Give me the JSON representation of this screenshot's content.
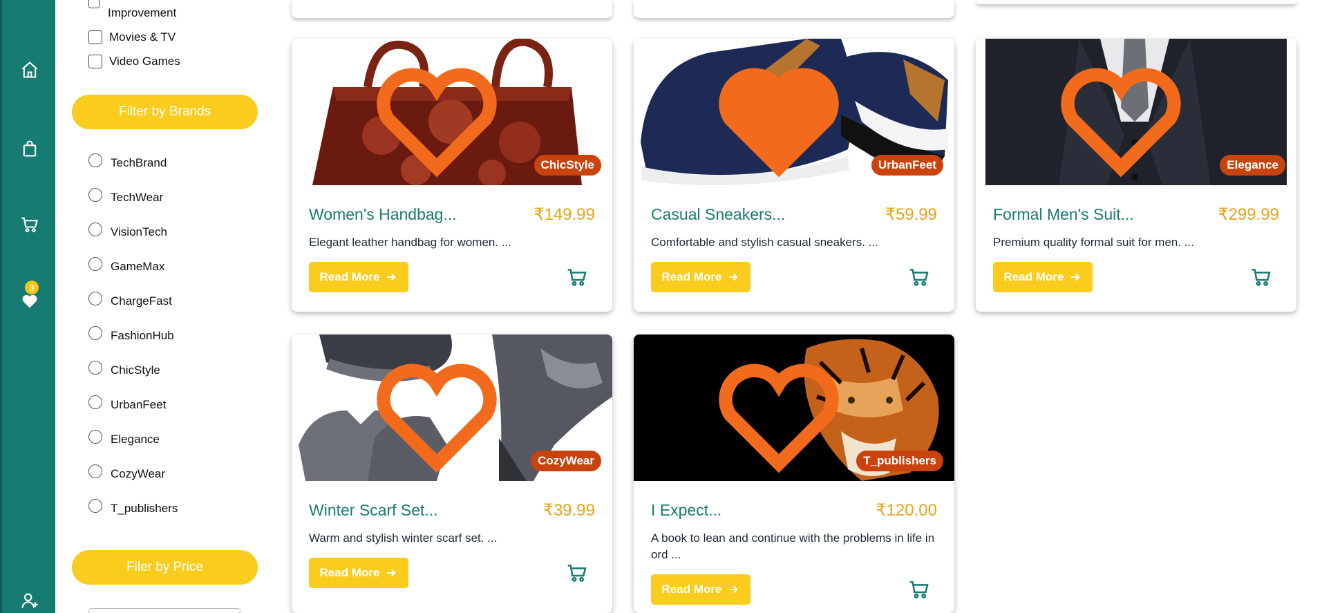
{
  "sidebar": {
    "wishlist_count": "3"
  },
  "filters": {
    "categories": [
      {
        "label": "Improvement"
      },
      {
        "label": "Movies & TV"
      },
      {
        "label": "Video Games"
      }
    ],
    "brands_button": "Filter by Brands",
    "brands": [
      "TechBrand",
      "TechWear",
      "VisionTech",
      "GameMax",
      "ChargeFast",
      "FashionHub",
      "ChicStyle",
      "UrbanFeet",
      "Elegance",
      "CozyWear",
      "T_publishers"
    ],
    "price_button": "Filer by Price"
  },
  "products": [
    {
      "title": "Women's Handbag...",
      "price": "₹149.99",
      "brand": "ChicStyle",
      "desc": "Elegant leather handbag for women. ...",
      "read_more": "Read More",
      "wishlisted": false
    },
    {
      "title": "Casual Sneakers...",
      "price": "₹59.99",
      "brand": "UrbanFeet",
      "desc": "Comfortable and stylish casual sneakers. ...",
      "read_more": "Read More",
      "wishlisted": true
    },
    {
      "title": "Formal Men's Suit...",
      "price": "₹299.99",
      "brand": "Elegance",
      "desc": "Premium quality formal suit for men. ...",
      "read_more": "Read More",
      "wishlisted": false
    },
    {
      "title": "Winter Scarf Set...",
      "price": "₹39.99",
      "brand": "CozyWear",
      "desc": "Warm and stylish winter scarf set. ...",
      "read_more": "Read More",
      "wishlisted": false
    },
    {
      "title": "I Expect...",
      "price": "₹120.00",
      "brand": "T_publishers",
      "desc": "A book to lean and continue with the problems in life in ord ...",
      "read_more": "Read More",
      "wishlisted": false
    }
  ],
  "colors": {
    "teal": "#167b70",
    "yellow": "#f9cc1d",
    "price": "#e8a317",
    "tag": "#c8430e",
    "heart": "#f26b1d"
  }
}
